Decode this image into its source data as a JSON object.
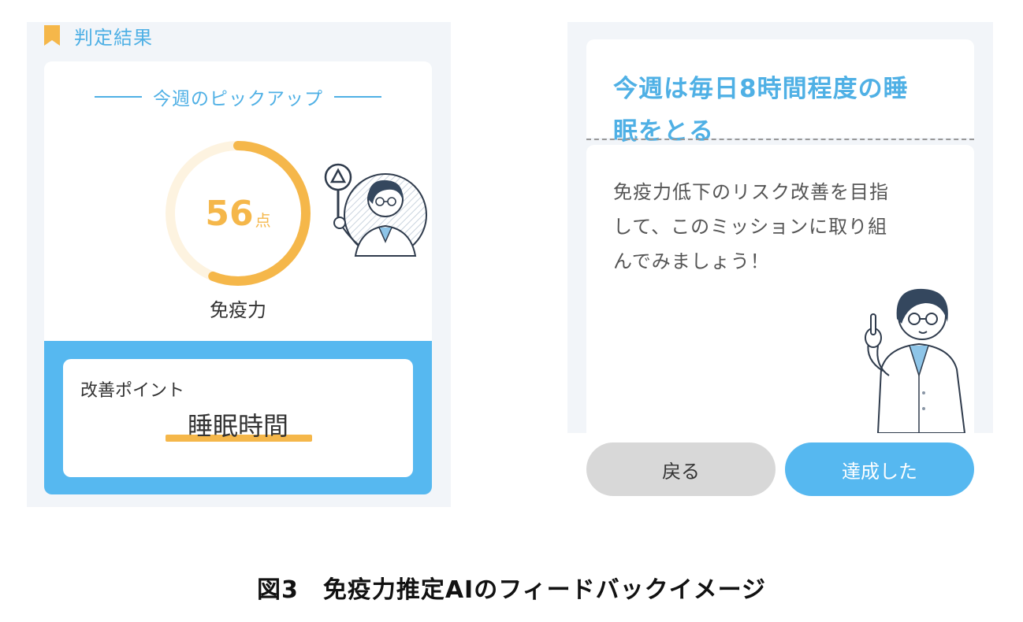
{
  "result": {
    "header": "判定結果",
    "pickup_title": "今週のピックアップ",
    "score_value": "56",
    "score_unit": "点",
    "score_fraction": 0.56,
    "metric_name": "免疫力",
    "improve_label": "改善ポイント",
    "improve_value": "睡眠時間"
  },
  "mission": {
    "title_line1": "今週は毎日8時間程度の睡",
    "title_line2": "眠をとる",
    "message_line1": "免疫力低下のリスク改善を目指",
    "message_line2": "して、このミッションに取り組",
    "message_line3": "んでみましょう！",
    "back_label": "戻る",
    "done_label": "達成した"
  },
  "caption": "図3　免疫力推定AIのフィードバックイメージ",
  "colors": {
    "accent_blue": "#4fb0e5",
    "band_blue": "#56b8f0",
    "score_orange": "#f5b74a",
    "gauge_track": "#fdf3e0",
    "panel_bg": "#f2f5f9"
  },
  "icons": {
    "header": "bookmark-icon",
    "doctor_badge": "doctor-holding-triangle-sign-icon",
    "doctor_figure": "doctor-pointing-finger-icon"
  }
}
